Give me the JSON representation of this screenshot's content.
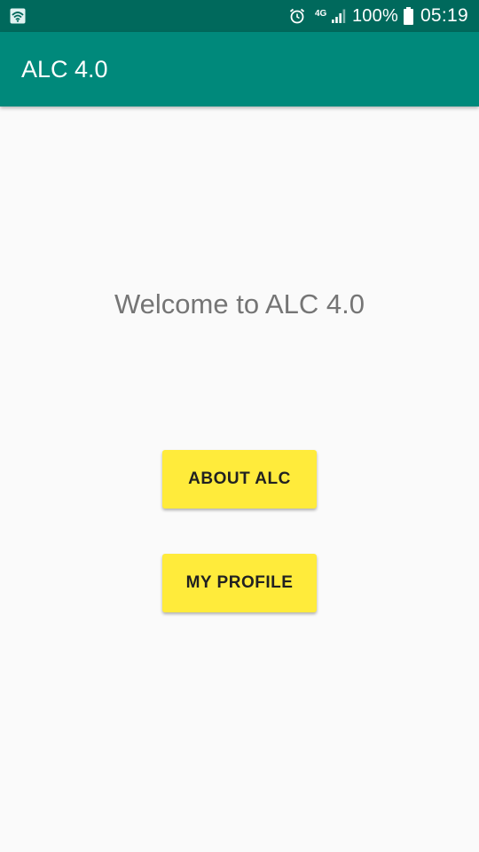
{
  "status_bar": {
    "left_icon": "wifi-box-icon",
    "alarm_icon": "alarm-clock-icon",
    "network_type": "4G",
    "signal_icon": "cell-signal-icon",
    "battery_percent": "100%",
    "battery_icon": "battery-icon",
    "time": "05:19"
  },
  "app_bar": {
    "title": "ALC 4.0"
  },
  "main": {
    "welcome_text": "Welcome to ALC 4.0",
    "buttons": [
      {
        "label": "ABOUT ALC"
      },
      {
        "label": "MY PROFILE"
      }
    ]
  },
  "colors": {
    "status_bar": "#00695c",
    "app_bar": "#00897b",
    "button": "#ffeb3b",
    "background": "#fafafa",
    "welcome_text": "#757575"
  }
}
